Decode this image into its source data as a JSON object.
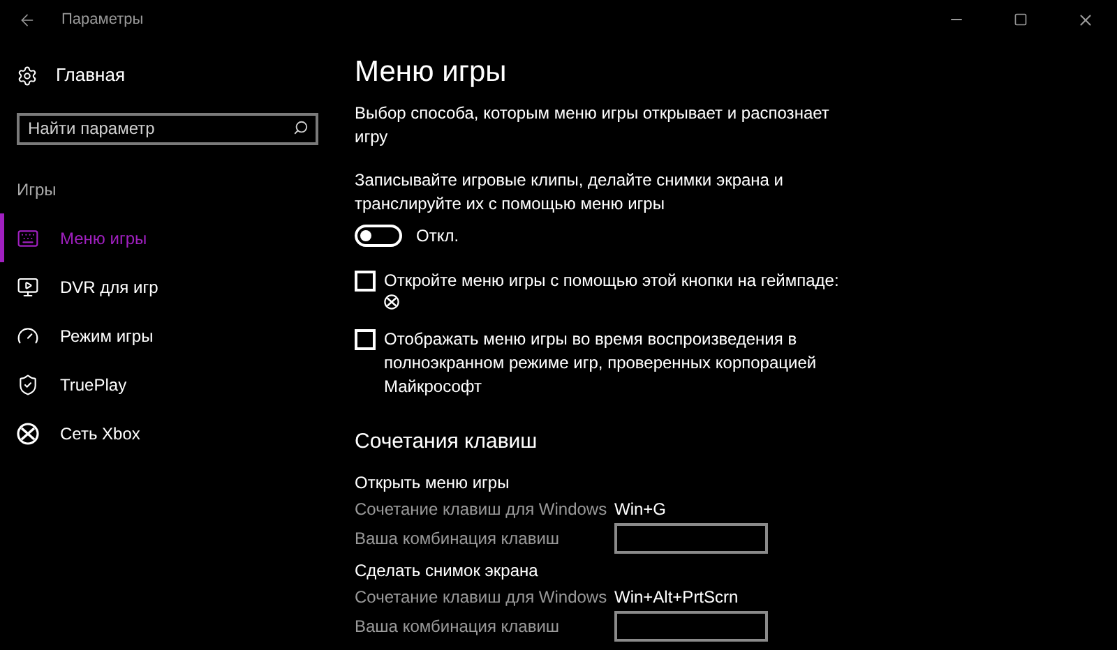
{
  "window": {
    "title": "Параметры"
  },
  "sidebar": {
    "home": "Главная",
    "search": {
      "placeholder": "Найти параметр"
    },
    "section": "Игры",
    "items": [
      {
        "label": "Меню игры",
        "selected": true
      },
      {
        "label": "DVR для игр",
        "selected": false
      },
      {
        "label": "Режим игры",
        "selected": false
      },
      {
        "label": "TruePlay",
        "selected": false
      },
      {
        "label": "Сеть Xbox",
        "selected": false
      }
    ]
  },
  "content": {
    "title": "Меню игры",
    "description": "Выбор способа, которым меню игры открывает и распознает игру",
    "toggle": {
      "label": "Записывайте игровые клипы, делайте снимки экрана и транслируйте их с помощью меню игры",
      "on": false,
      "state_text": "Откл."
    },
    "checkboxes": [
      {
        "label": "Откройте меню игры с помощью этой кнопки на геймпаде:",
        "checked": false,
        "kind": "gamepad"
      },
      {
        "label": "Отображать меню игры во время воспроизведения в полноэкранном режиме игр, проверенных корпорацией Майкрософт",
        "checked": false,
        "kind": "plain"
      }
    ],
    "shortcuts_title": "Сочетания клавиш",
    "shortcuts": [
      {
        "title": "Открыть меню игры",
        "windows_label": "Сочетание клавиш для Windows",
        "windows_value": "Win+G",
        "custom_label": "Ваша комбинация клавиш"
      },
      {
        "title": "Сделать снимок экрана",
        "windows_label": "Сочетание клавиш для Windows",
        "windows_value": "Win+Alt+PrtScrn",
        "custom_label": "Ваша комбинация клавиш"
      }
    ]
  }
}
